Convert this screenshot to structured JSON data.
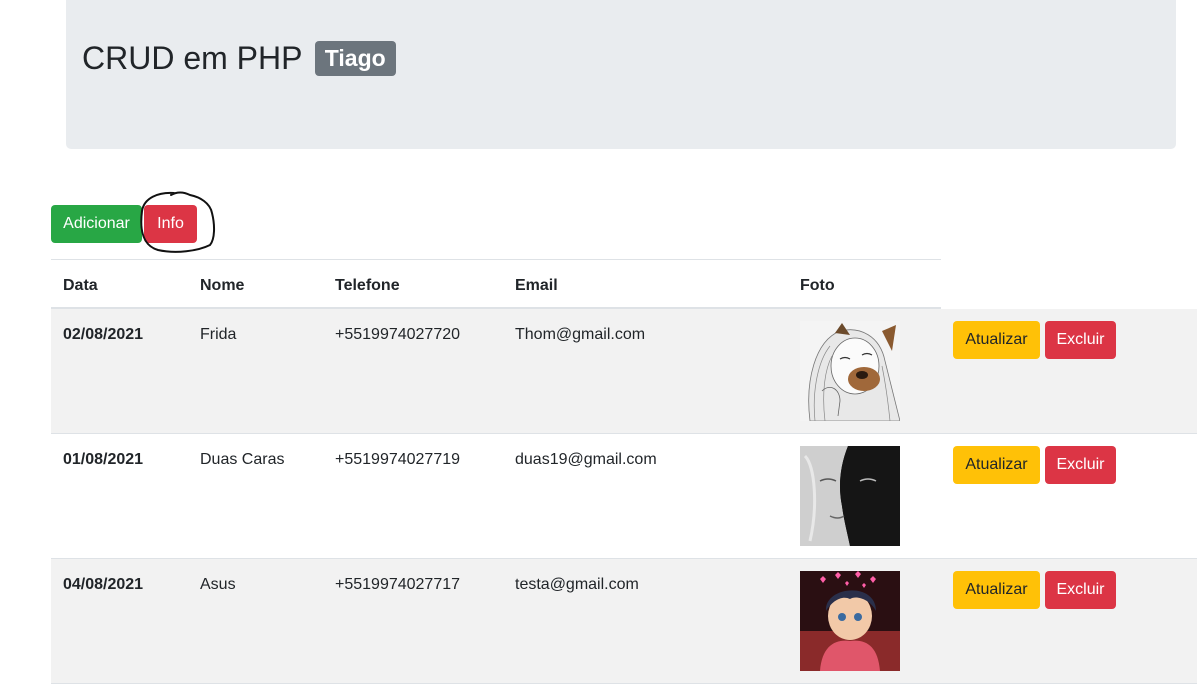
{
  "header": {
    "title": "CRUD em PHP",
    "badge": "Tiago"
  },
  "toolbar": {
    "add_label": "Adicionar",
    "info_label": "Info"
  },
  "table": {
    "columns": [
      "Data",
      "Nome",
      "Telefone",
      "Email",
      "Foto"
    ],
    "rows": [
      {
        "data": "02/08/2021",
        "nome": "Frida",
        "telefone": "+5519974027720",
        "email": "Thom@gmail.com",
        "foto": "sketch-girl-dog-filter-photo"
      },
      {
        "data": "01/08/2021",
        "nome": "Duas Caras",
        "telefone": "+5519974027719",
        "email": "duas19@gmail.com",
        "foto": "two-faced-portrait-photo"
      },
      {
        "data": "04/08/2021",
        "nome": "Asus",
        "telefone": "+5519974027717",
        "email": "testa@gmail.com",
        "foto": "anime-boy-hearts-photo"
      }
    ],
    "actions": {
      "update_label": "Atualizar",
      "delete_label": "Excluir"
    }
  },
  "colors": {
    "success": "#28a745",
    "danger": "#dc3545",
    "warning": "#ffc107",
    "secondary": "#6c757d",
    "jumbotron": "#e9ecef",
    "stripe": "#f2f2f2"
  }
}
